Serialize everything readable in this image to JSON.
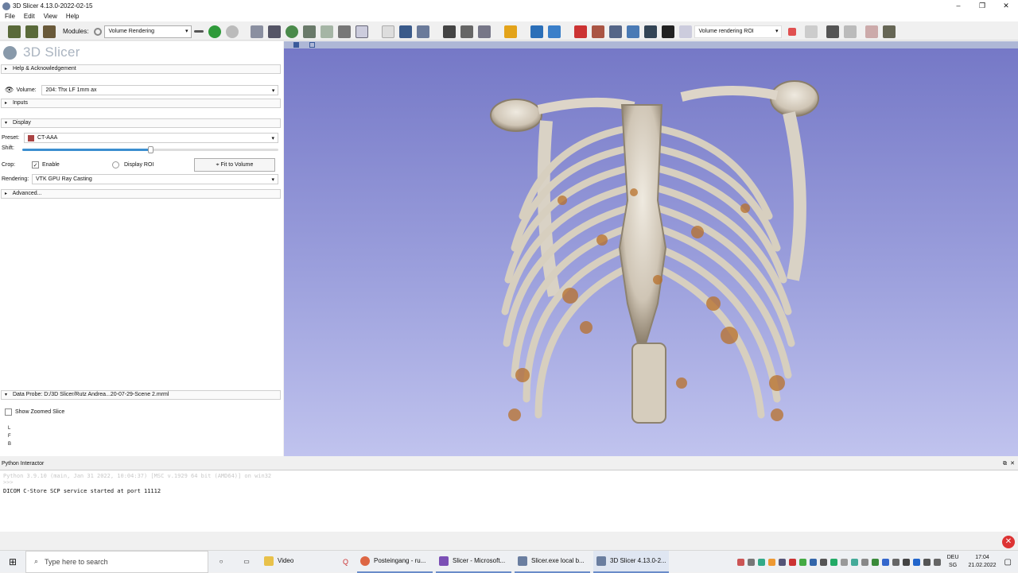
{
  "window": {
    "title": "3D Slicer 4.13.0-2022-02-15"
  },
  "menu": {
    "items": [
      "File",
      "Edit",
      "View",
      "Help"
    ]
  },
  "toolbar": {
    "modules_label": "Modules:",
    "module_select": "Volume Rendering",
    "roi_select": "Volume rendering ROI"
  },
  "panel": {
    "brand": "3D Slicer",
    "help_section": "Help & Acknowledgement",
    "volume_label": "Volume:",
    "volume_value": "204: Thx  LF 1mm ax",
    "inputs_section": "Inputs",
    "display_section": "Display",
    "preset_label": "Preset:",
    "preset_value": "CT-AAA",
    "shift_label": "Shift:",
    "shift_value": 0.5,
    "crop_label": "Crop:",
    "enable_label": "Enable",
    "enable_checked": true,
    "display_roi_label": "Display ROI",
    "fit_button": "Fit to Volume",
    "rendering_label": "Rendering:",
    "rendering_value": "VTK GPU Ray Casting",
    "advanced_section": "Advanced...",
    "data_probe_section": "Data Probe: D:/3D Slicer/Rutz Andrea...20-07-29-Scene 2.mrml",
    "show_zoomed_label": "Show Zoomed Slice",
    "probe_letters": [
      "L",
      "F",
      "B"
    ]
  },
  "python": {
    "bar_label": "Python Interactor",
    "lines_dim": [
      "Python 3.9.10 (main, Jan 31 2022, 10:04:37) [MSC v.1929 64 bit (AMD64)] on win32",
      ">>>"
    ],
    "line_main": "DICOM C-Store SCP service started at port 11112"
  },
  "taskbar": {
    "search_placeholder": "Type here to search",
    "tasks": [
      "Video",
      "Posteingang - ru...",
      "Slicer - Microsoft...",
      "Slicer.exe local b...",
      "3D Slicer 4.13.0-2..."
    ],
    "lang_line1": "DEU",
    "lang_line2": "SG",
    "time": "17:04",
    "date": "21.02.2022"
  },
  "colors": {
    "view_bg_top": "#7477c6",
    "view_bg_bottom": "#c0c3ee",
    "accent": "#3c8fd0"
  }
}
